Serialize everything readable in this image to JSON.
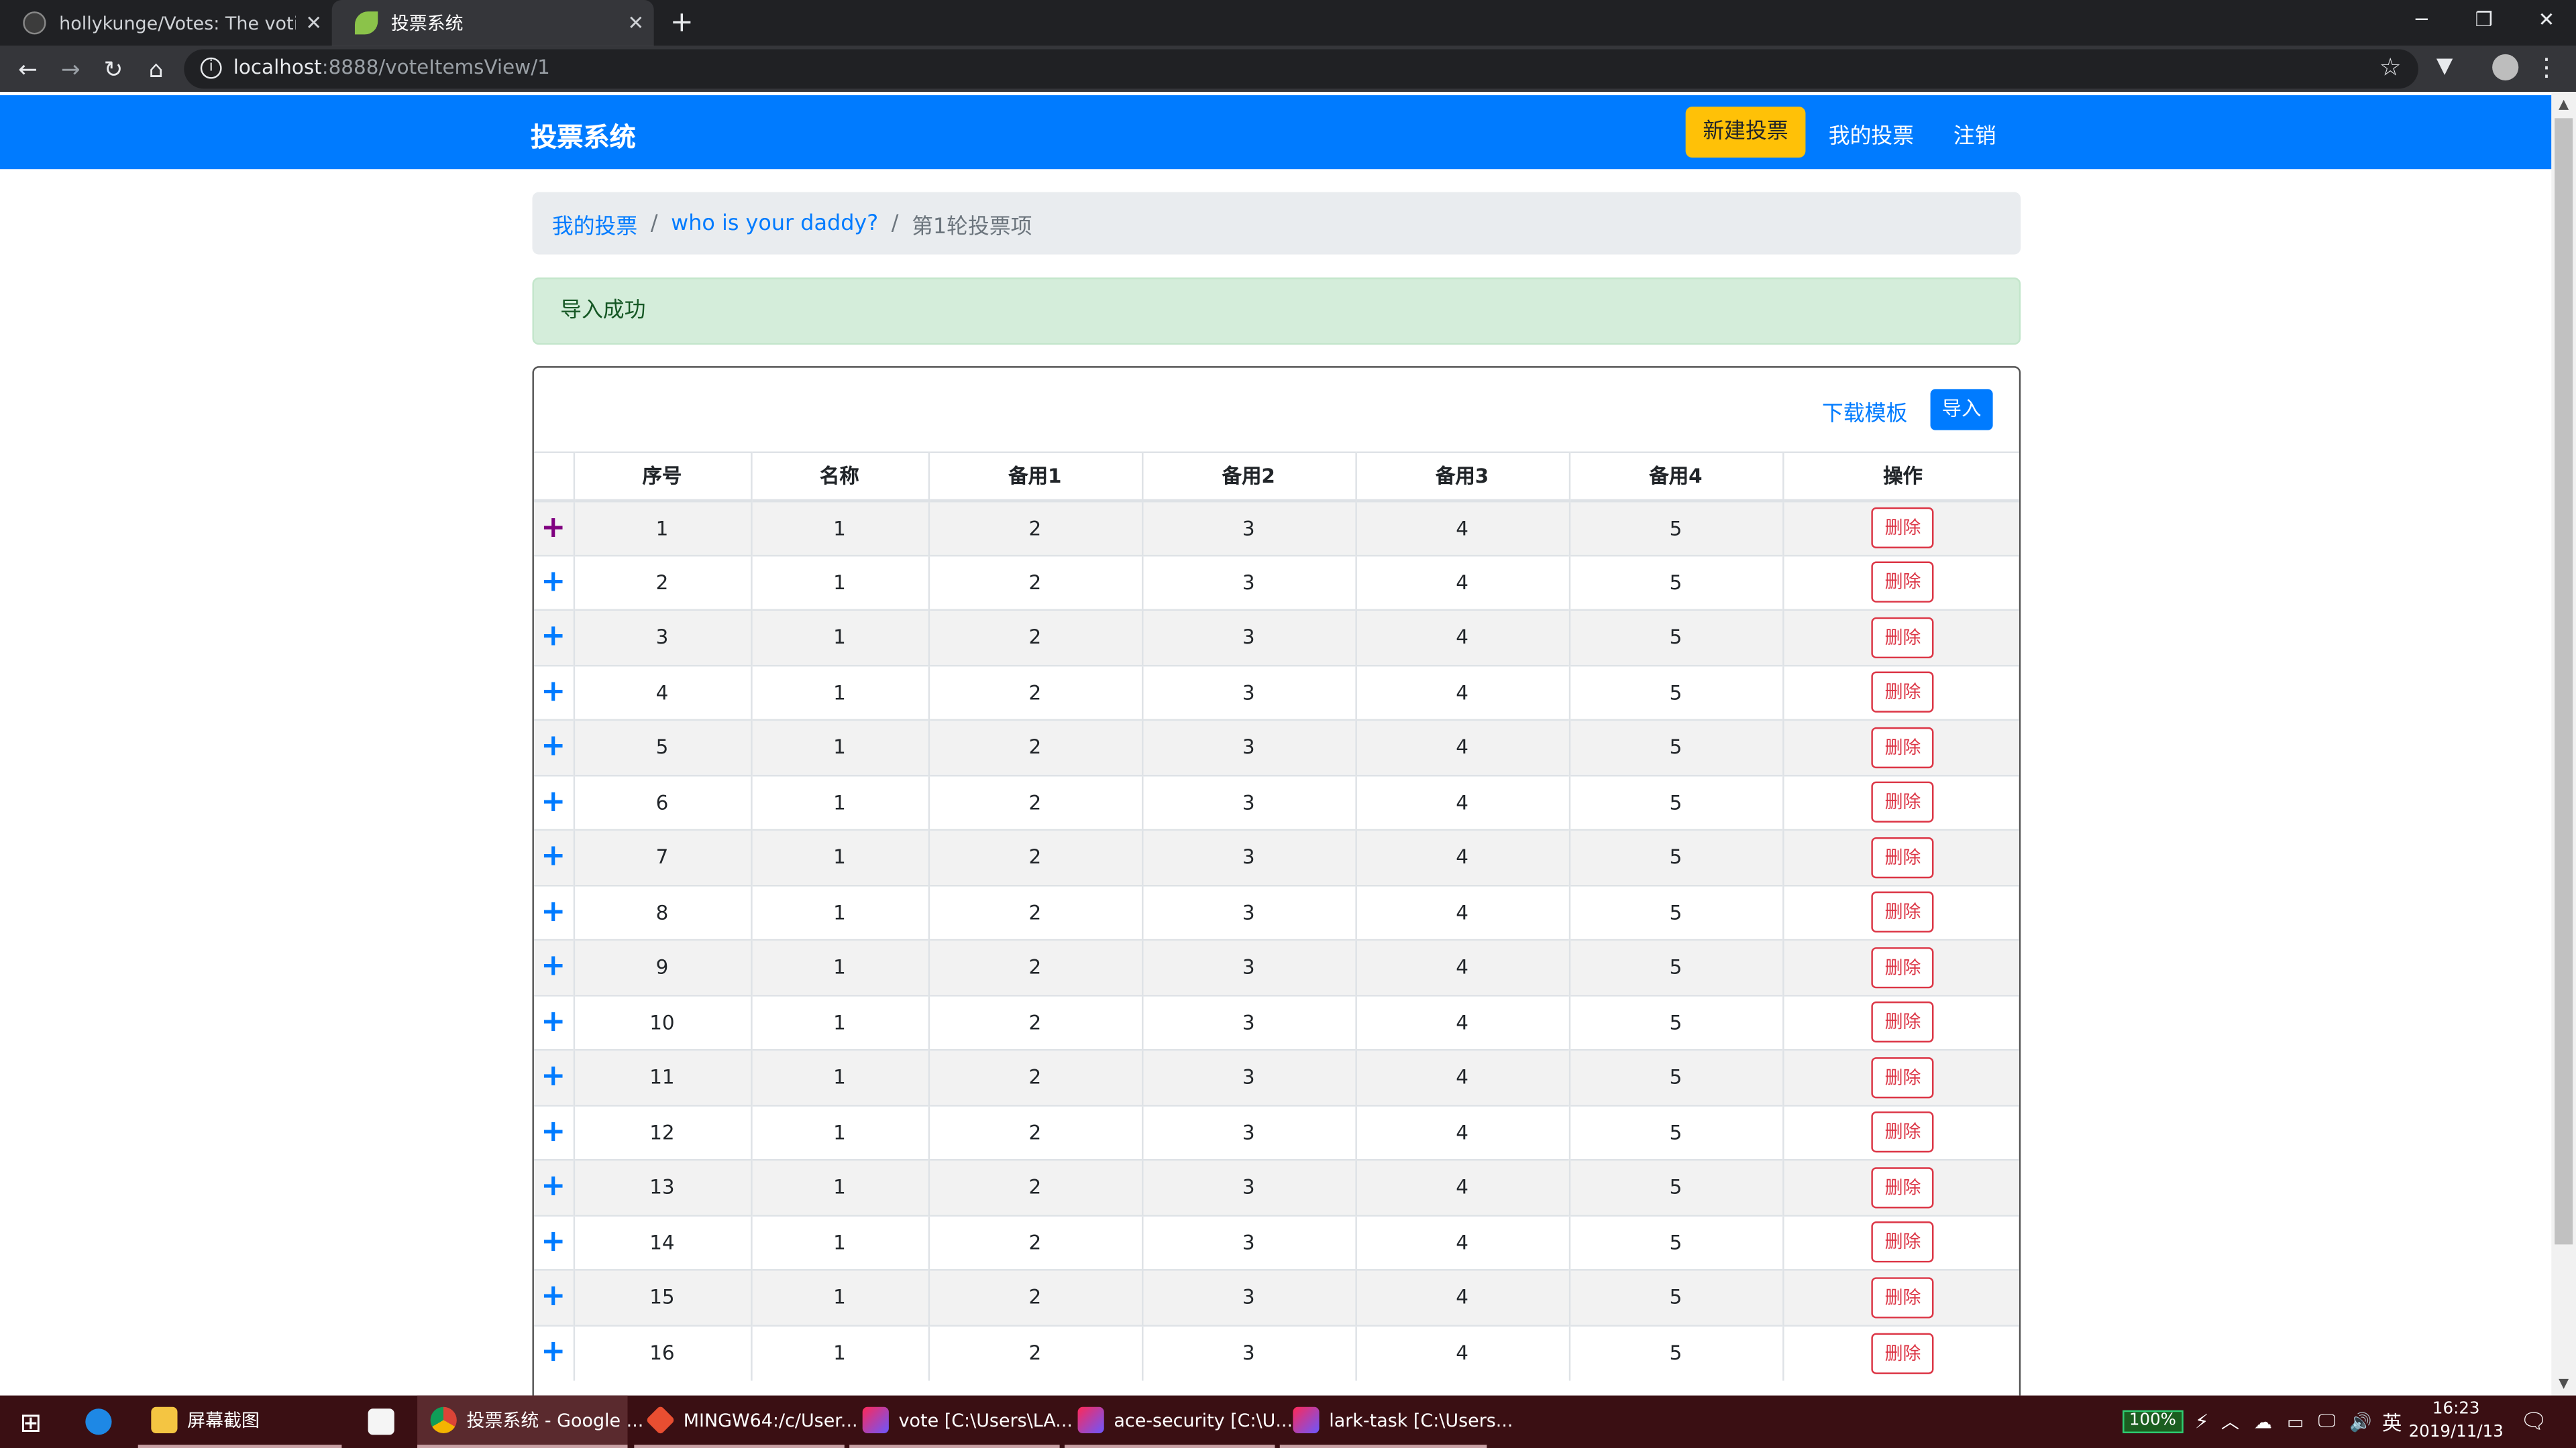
{
  "browser": {
    "tabs": [
      {
        "title": "hollykunge/Votes: The voting"
      },
      {
        "title": "投票系统"
      }
    ],
    "address": {
      "host": "localhost",
      "rest": ":8888/voteItemsView/1"
    }
  },
  "navbar": {
    "brand": "投票系统",
    "new_vote": "新建投票",
    "my_votes": "我的投票",
    "logout": "注销"
  },
  "breadcrumb": {
    "items": [
      "我的投票",
      "who is your daddy?"
    ],
    "current": "第1轮投票项"
  },
  "alert": {
    "message": "导入成功"
  },
  "panel": {
    "download_template": "下载模板",
    "import": "导入"
  },
  "table": {
    "headers": [
      "序号",
      "名称",
      "备用1",
      "备用2",
      "备用3",
      "备用4",
      "操作"
    ],
    "delete_label": "删除",
    "rows": [
      [
        "1",
        "1",
        "2",
        "3",
        "4",
        "5"
      ],
      [
        "2",
        "1",
        "2",
        "3",
        "4",
        "5"
      ],
      [
        "3",
        "1",
        "2",
        "3",
        "4",
        "5"
      ],
      [
        "4",
        "1",
        "2",
        "3",
        "4",
        "5"
      ],
      [
        "5",
        "1",
        "2",
        "3",
        "4",
        "5"
      ],
      [
        "6",
        "1",
        "2",
        "3",
        "4",
        "5"
      ],
      [
        "7",
        "1",
        "2",
        "3",
        "4",
        "5"
      ],
      [
        "8",
        "1",
        "2",
        "3",
        "4",
        "5"
      ],
      [
        "9",
        "1",
        "2",
        "3",
        "4",
        "5"
      ],
      [
        "10",
        "1",
        "2",
        "3",
        "4",
        "5"
      ],
      [
        "11",
        "1",
        "2",
        "3",
        "4",
        "5"
      ],
      [
        "12",
        "1",
        "2",
        "3",
        "4",
        "5"
      ],
      [
        "13",
        "1",
        "2",
        "3",
        "4",
        "5"
      ],
      [
        "14",
        "1",
        "2",
        "3",
        "4",
        "5"
      ],
      [
        "15",
        "1",
        "2",
        "3",
        "4",
        "5"
      ],
      [
        "16",
        "1",
        "2",
        "3",
        "4",
        "5"
      ]
    ]
  },
  "taskbar": {
    "items": [
      {
        "label": "屏幕截图",
        "icon": "folder-icon"
      },
      {
        "label": "投票系统 - Google ...",
        "icon": "chrome-icon"
      },
      {
        "label": "MINGW64:/c/User...",
        "icon": "git-bash-icon"
      },
      {
        "label": "vote [C:\\Users\\LA...",
        "icon": "intellij-icon"
      },
      {
        "label": "ace-security [C:\\U...",
        "icon": "intellij-icon"
      },
      {
        "label": "lark-task [C:\\Users...",
        "icon": "intellij-icon"
      }
    ],
    "battery": "100%",
    "ime": "英",
    "time": "16:23",
    "date": "2019/11/13"
  },
  "colors": {
    "primary": "#007bff",
    "warning": "#ffc107",
    "danger": "#dc3545",
    "success_bg": "#d4edda",
    "taskbar": "#3a0f13"
  }
}
